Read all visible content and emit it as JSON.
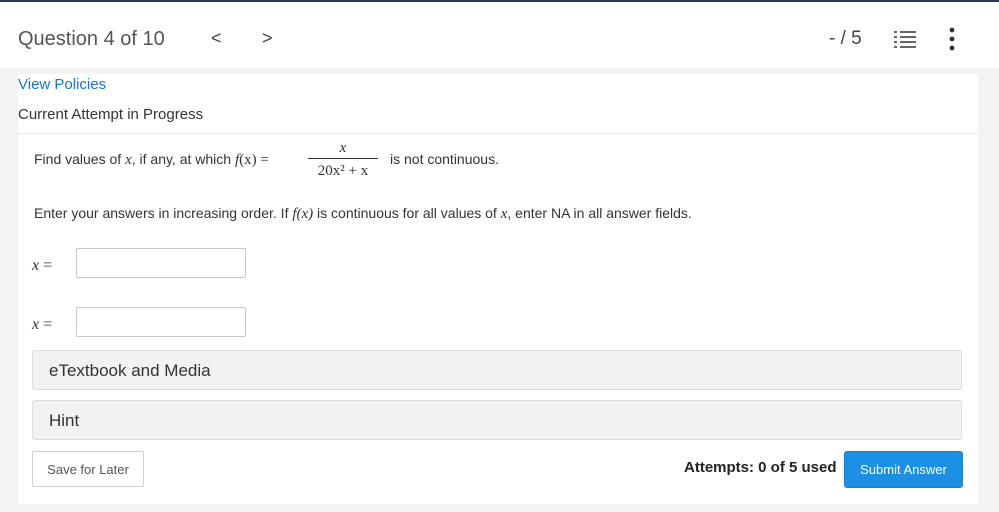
{
  "header": {
    "question_label": "Question 4 of 10",
    "prev_glyph": "<",
    "next_glyph": ">",
    "score": "- / 5"
  },
  "policies_link": "View Policies",
  "attempt_status": "Current Attempt in Progress",
  "question": {
    "text_before": "Find values of ",
    "var_x": "x",
    "text_mid": ",  if any, at which ",
    "f": "f",
    "paren_x": "(x)",
    "equals": " =",
    "numerator": "x",
    "denominator_html": "20x² + x",
    "text_after": "is not continuous."
  },
  "instructions": {
    "part1": "Enter your answers in increasing order. If ",
    "fx": "f(x)",
    "part2": " is continuous for all values of ",
    "x": "x",
    "part3": ", enter NA in all answer fields."
  },
  "answers": [
    {
      "label_var": "x",
      "label_eq": " =",
      "value": ""
    },
    {
      "label_var": "x",
      "label_eq": " =",
      "value": ""
    }
  ],
  "panels": {
    "etextbook": "eTextbook and Media",
    "hint": "Hint"
  },
  "footer": {
    "save_label": "Save for Later",
    "attempts_text": "Attempts: 0 of 5 used",
    "submit_label": "Submit Answer"
  },
  "icons": {
    "list": "question-list-icon",
    "more": "more-vertical-icon"
  },
  "colors": {
    "link": "#1a73c9",
    "submit": "#1a8fe3",
    "top_border": "#2b3a55"
  }
}
